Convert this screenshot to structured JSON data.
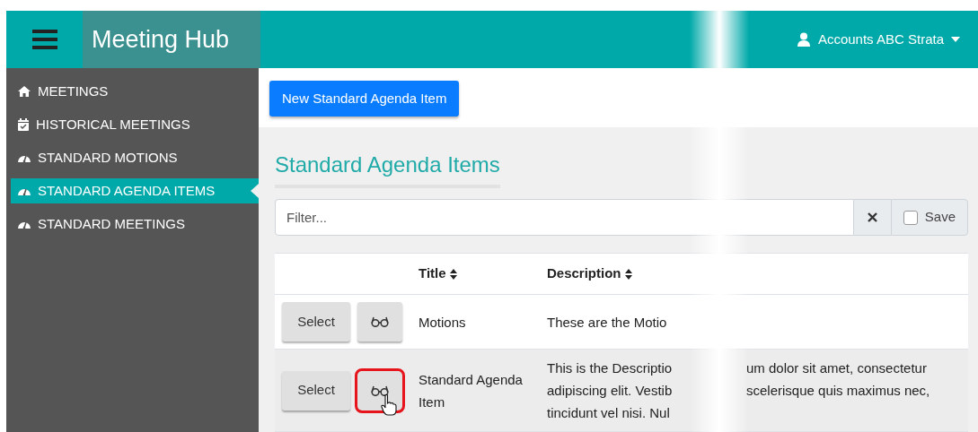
{
  "header": {
    "title": "Meeting Hub",
    "user": "Accounts ABC Strata"
  },
  "sidebar": {
    "items": [
      {
        "label": "MEETINGS",
        "kind": "home",
        "selected": false
      },
      {
        "label": "HISTORICAL MEETINGS",
        "kind": "calendar",
        "selected": false
      },
      {
        "label": "STANDARD MOTIONS",
        "kind": "gauge",
        "selected": false
      },
      {
        "label": "STANDARD AGENDA ITEMS",
        "kind": "gauge",
        "selected": true
      },
      {
        "label": "STANDARD MEETINGS",
        "kind": "gauge",
        "selected": false
      }
    ]
  },
  "new_button": "New Standard Agenda Item",
  "page_title": "Standard Agenda Items",
  "filter": {
    "placeholder": "Filter...",
    "save_label": "Save",
    "save_checked": false
  },
  "table": {
    "columns": [
      "Title",
      "Description"
    ],
    "rows": [
      {
        "select": "Select",
        "title": "Motions",
        "hovered": false,
        "view_emphasized": false,
        "description_lines": [
          {
            "left": "These are the Motio"
          }
        ]
      },
      {
        "select": "Select",
        "title": "Standard Agenda Item",
        "hovered": true,
        "view_emphasized": true,
        "description_lines": [
          {
            "left": "This is the Descriptio",
            "right": "um dolor sit amet, consectetur"
          },
          {
            "left": "adipiscing elit. Vestib",
            "right": "scelerisque quis maximus nec,"
          },
          {
            "left": "tincidunt vel nisi. Nul"
          }
        ]
      }
    ]
  }
}
